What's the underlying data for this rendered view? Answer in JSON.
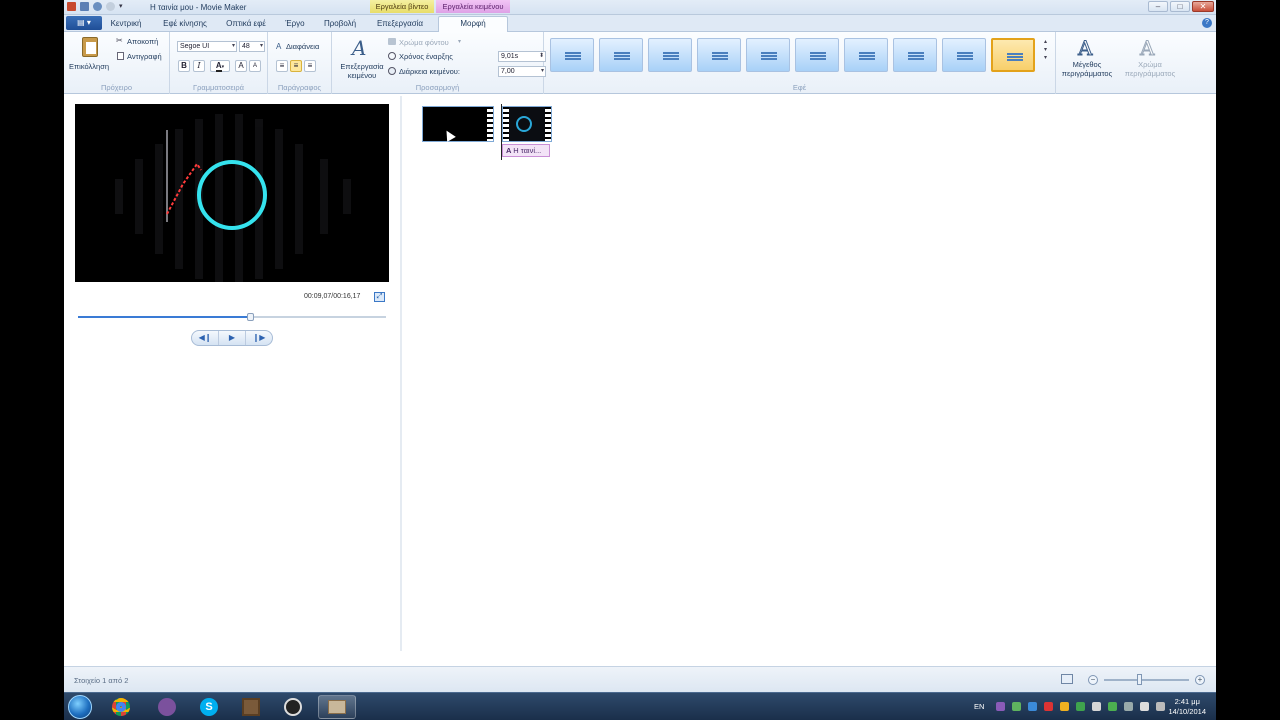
{
  "window": {
    "title": "Η ταινία μου - Movie Maker",
    "contextual_tabs": {
      "video_tools": "Εργαλεία βίντεο",
      "text_tools": "Εργαλεία κειμένου"
    },
    "controls": {
      "minimize": "–",
      "maximize": "□",
      "close": "✕"
    }
  },
  "tabs": {
    "file": "▤ ▾",
    "items": [
      "Κεντρική",
      "Εφέ κίνησης",
      "Οπτικά εφέ",
      "Έργο",
      "Προβολή",
      "Επεξεργασία",
      "Μορφή"
    ],
    "active": "Μορφή",
    "help": "?"
  },
  "ribbon": {
    "clipboard": {
      "paste": "Επικόλληση",
      "cut": "Αποκοπή",
      "copy": "Αντιγραφή",
      "label": "Πρόχειρο"
    },
    "font": {
      "family": "Segoe UI",
      "size": "48",
      "bold": "B",
      "italic": "I",
      "color": "A",
      "grow": "A",
      "shrink": "A",
      "label": "Γραμματοσειρά"
    },
    "paragraph": {
      "transparency": "Διαφάνεια",
      "label": "Παράγραφος"
    },
    "adjust": {
      "edit_text": "Επεξεργασία κειμένου",
      "bg_color": "Χρώμα φόντου",
      "start_time_label": "Χρόνος έναρξης",
      "start_time_value": "9,01s",
      "duration_label": "Διάρκεια κειμένου:",
      "duration_value": "7,00",
      "label": "Προσαρμογή"
    },
    "effects": {
      "label": "Εφέ",
      "count": 10,
      "selected_index": 9
    },
    "outline": {
      "size": "Μέγεθος περιγράμματος",
      "color": "Χρώμα περιγράμματος"
    }
  },
  "preview": {
    "timecode": "00:09,07/00:16,17",
    "progress": 0.56
  },
  "storyboard": {
    "caption": "Η ταινί..."
  },
  "status": {
    "items": "Στοιχείο 1 από 2",
    "zoom_minus": "−",
    "zoom_plus": "+"
  },
  "taskbar": {
    "language": "EN",
    "time": "2:41 μμ",
    "date": "14/10/2014"
  }
}
